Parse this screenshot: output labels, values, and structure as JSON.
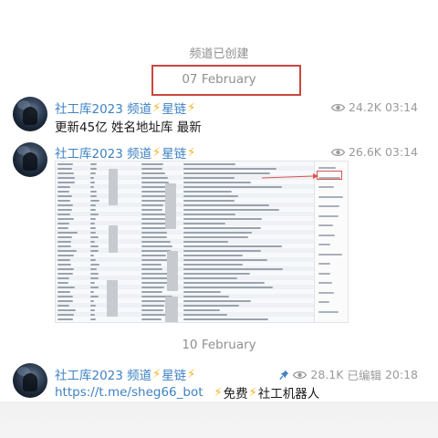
{
  "system_notice": "频道已创建",
  "dates": {
    "first": "07 February",
    "second": "10 February"
  },
  "messages": [
    {
      "sender": "社工库2023 频道",
      "sender_suffix": "星链",
      "views": "24.2K",
      "time": "03:14",
      "text": "更新45亿 姓名地址库 最新"
    },
    {
      "sender": "社工库2023 频道",
      "sender_suffix": "星链",
      "views": "26.6K",
      "time": "03:14",
      "attachment": "screenshot-image"
    },
    {
      "sender": "社工库2023 频道",
      "sender_suffix": "星链",
      "views": "28.1K",
      "edited": "已编辑",
      "time": "20:18",
      "link": "https://t.me/sheg66_bot",
      "tail_a": "免费",
      "tail_b": "社工机器人"
    }
  ],
  "icons": {
    "bolt": "⚡",
    "views": "eye-icon",
    "pinned": "pin-icon"
  },
  "colors": {
    "sender": "#3e82c4",
    "meta": "#9a9a9a",
    "annotation": "#c9473f",
    "bolt": "#f1b41c"
  }
}
